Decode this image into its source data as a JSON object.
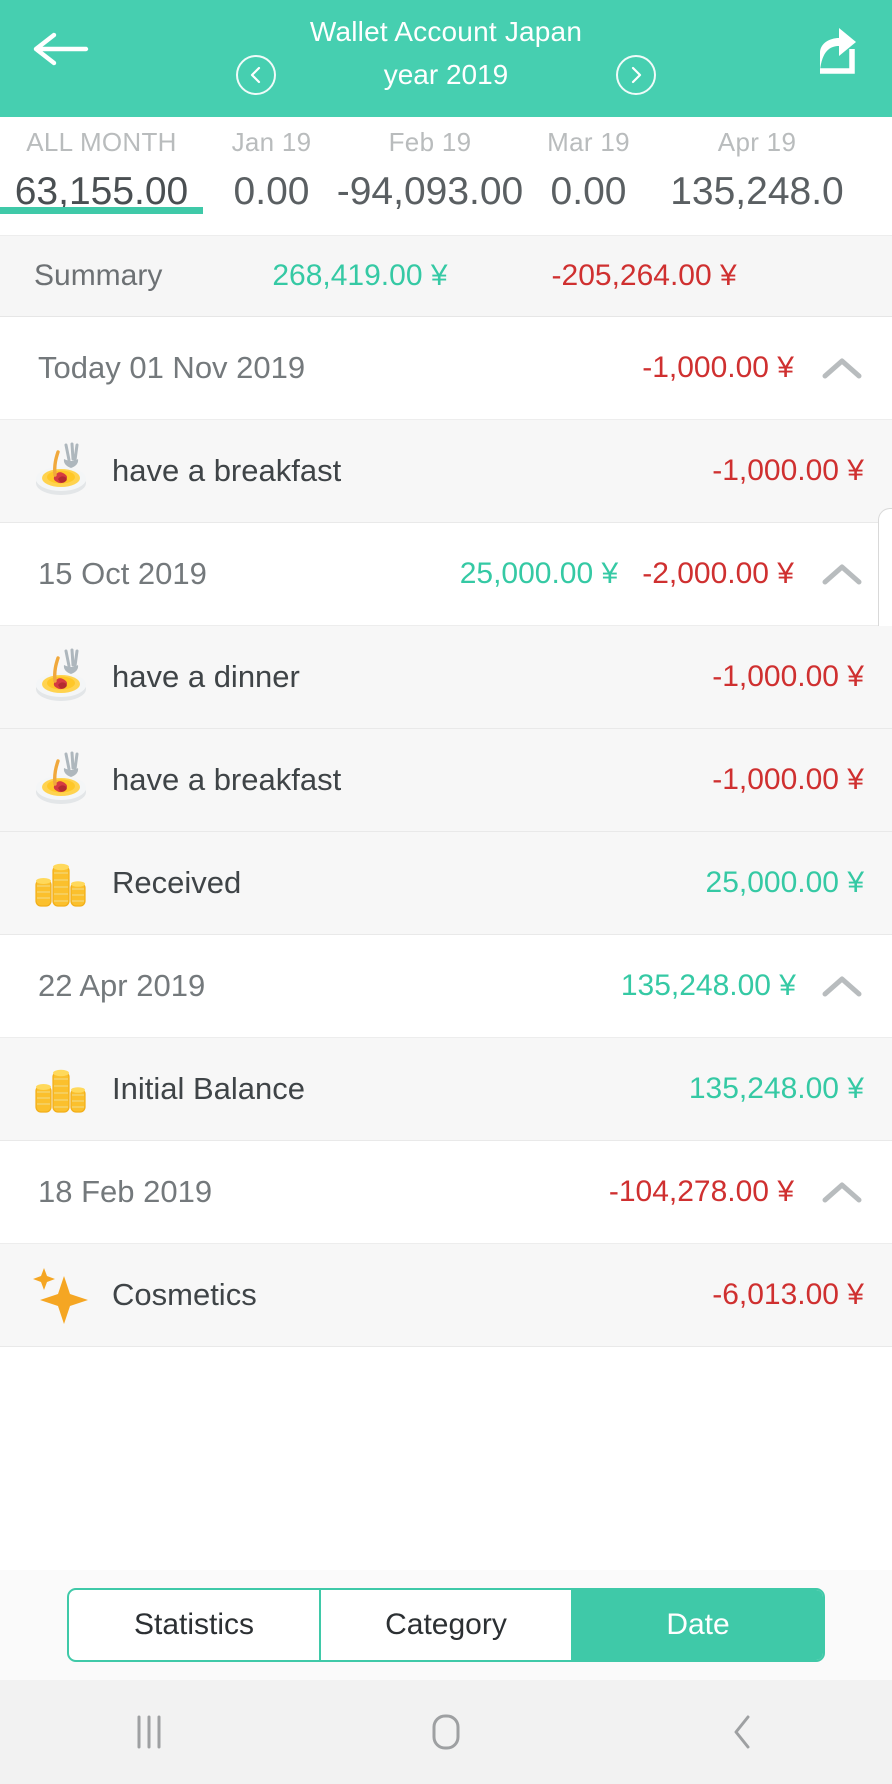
{
  "header": {
    "title": "Wallet Account Japan",
    "period_label": "year 2019",
    "back_icon": "arrow-left-icon",
    "share_icon": "share-icon",
    "prev_icon": "chevron-left-circle-icon",
    "next_icon": "chevron-right-circle-icon",
    "accent_color": "#46cfb0"
  },
  "month_tabs": [
    {
      "label": "ALL MONTH",
      "value": "63,155.00",
      "active": true
    },
    {
      "label": "Jan 19",
      "value": "0.00",
      "active": false
    },
    {
      "label": "Feb 19",
      "value": "-94,093.00",
      "active": false
    },
    {
      "label": "Mar 19",
      "value": "0.00",
      "active": false
    },
    {
      "label": "Apr 19",
      "value": "135,248.0",
      "active": false
    }
  ],
  "summary": {
    "label": "Summary",
    "income": "268,419.00 ¥",
    "expense": "-205,264.00 ¥",
    "income_color": "#35c9a4",
    "expense_color": "#cf3030"
  },
  "groups": [
    {
      "date": "Today 01 Nov 2019",
      "income": "",
      "expense": "-1,000.00 ¥",
      "collapse_icon": "chevron-up-icon",
      "transactions": [
        {
          "icon": "food-plate-icon",
          "title": "have a breakfast",
          "amount": "-1,000.00 ¥",
          "sign": "neg"
        }
      ]
    },
    {
      "date": "15 Oct 2019",
      "income": "25,000.00 ¥",
      "expense": "-2,000.00 ¥",
      "collapse_icon": "chevron-up-icon",
      "transactions": [
        {
          "icon": "food-plate-icon",
          "title": "have a dinner",
          "amount": "-1,000.00 ¥",
          "sign": "neg"
        },
        {
          "icon": "food-plate-icon",
          "title": "have a breakfast",
          "amount": "-1,000.00 ¥",
          "sign": "neg"
        },
        {
          "icon": "coins-icon",
          "title": "Received",
          "amount": "25,000.00 ¥",
          "sign": "pos"
        }
      ]
    },
    {
      "date": "22 Apr 2019",
      "income": "135,248.00 ¥",
      "expense": "",
      "collapse_icon": "chevron-up-icon",
      "transactions": [
        {
          "icon": "coins-icon",
          "title": "Initial Balance",
          "amount": "135,248.00 ¥",
          "sign": "pos"
        }
      ]
    },
    {
      "date": "18 Feb 2019",
      "income": "",
      "expense": "-104,278.00 ¥",
      "collapse_icon": "chevron-up-icon",
      "transactions": [
        {
          "icon": "sparkle-icon",
          "title": "Cosmetics",
          "amount": "-6,013.00 ¥",
          "sign": "neg"
        }
      ]
    }
  ],
  "segmented": {
    "options": [
      {
        "label": "Statistics",
        "active": false
      },
      {
        "label": "Category",
        "active": false
      },
      {
        "label": "Date",
        "active": true
      }
    ]
  },
  "system_nav": {
    "recents_icon": "recents-icon",
    "home_icon": "home-icon",
    "back_icon": "back-chevron-icon"
  }
}
